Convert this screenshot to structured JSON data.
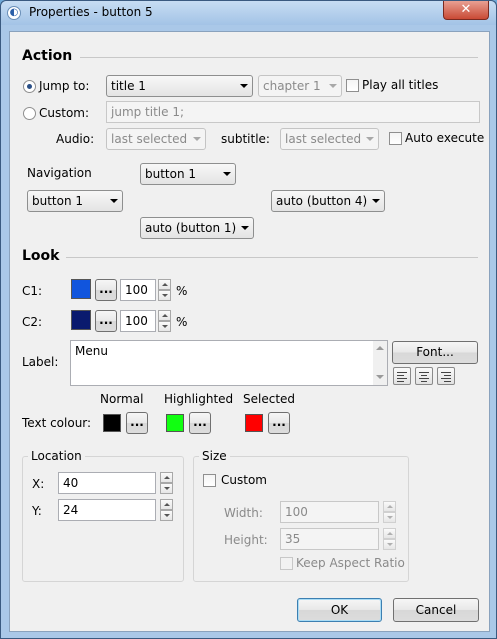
{
  "window": {
    "title": "Properties - button 5",
    "close_glyph": "✕"
  },
  "action": {
    "title": "Action",
    "jump_to_label": "Jump to:",
    "jump_to_selected": true,
    "jump_title_value": "title 1",
    "jump_chapter_value": "chapter 1",
    "play_all_titles_label": "Play all titles",
    "custom_label": "Custom:",
    "custom_command_value": "jump title 1;",
    "audio_label": "Audio:",
    "audio_value": "last selected",
    "subtitle_label": "subtitle:",
    "subtitle_value": "last selected",
    "auto_execute_label": "Auto execute"
  },
  "navigation": {
    "label": "Navigation",
    "up_value": "button 1",
    "left_value": "button 1",
    "right_value": "auto (button 4)",
    "down_value": "auto (button 1)"
  },
  "look": {
    "title": "Look",
    "c1_label": "C1:",
    "c1_color": "#1155dd",
    "c1_value": "100",
    "c2_label": "C2:",
    "c2_color": "#0a1a6e",
    "c2_value": "100",
    "percent": "%",
    "ellipsis": "...",
    "label_label": "Label:",
    "label_text": "Menu",
    "font_button": "Font...",
    "text_colour_label": "Text colour:",
    "normal_label": "Normal",
    "normal_color": "#000000",
    "highlighted_label": "Highlighted",
    "highlighted_color": "#11ff11",
    "selected_label": "Selected",
    "selected_color": "#ff0000"
  },
  "location": {
    "title": "Location",
    "x_label": "X:",
    "x_value": "40",
    "y_label": "Y:",
    "y_value": "24"
  },
  "size": {
    "title": "Size",
    "custom_label": "Custom",
    "width_label": "Width:",
    "width_value": "100",
    "height_label": "Height:",
    "height_value": "35",
    "keep_aspect_label": "Keep Aspect Ratio"
  },
  "buttons": {
    "ok": "OK",
    "cancel": "Cancel"
  }
}
